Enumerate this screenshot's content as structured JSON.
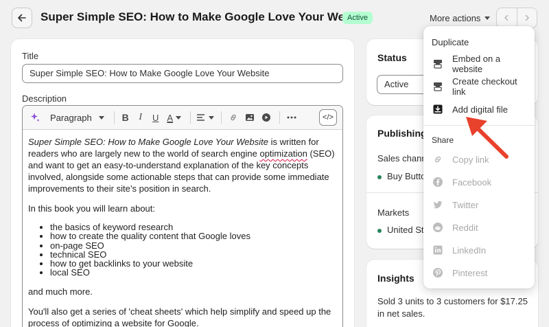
{
  "header": {
    "title": "Super Simple SEO: How to Make Google Love Your Website",
    "status_badge": "Active",
    "more_actions": "More actions"
  },
  "product": {
    "title_label": "Title",
    "title_value": "Super Simple SEO: How to Make Google Love Your Website",
    "description_label": "Description",
    "editor": {
      "paragraph_style": "Paragraph",
      "code_label": "</>",
      "intro_italic": "Super Simple SEO: How to Make Google Love Your Website",
      "intro_a": " is written for readers who are largely new to the world of search engine ",
      "intro_sq": "optimization",
      "intro_b": " (SEO) and want to get an easy-to-understand explanation of the key concepts involved, alongside some actionable steps that can provide some immediate improvements to their site’s position in search.",
      "learn_intro": "In this book you will learn about:",
      "bullets": [
        "the basics of keyword research",
        "how to create the quality content that Google loves",
        "on-page SEO",
        "technical SEO",
        "how to get backlinks to your website",
        "local SEO"
      ],
      "more": "and much more.",
      "cheat_a": "You'll also get a series of 'cheat sheets' which help simplify and speed up the process of ",
      "cheat_sq": "optimizing",
      "cheat_b": " a website for Google."
    }
  },
  "status_card": {
    "title": "Status",
    "value": "Active"
  },
  "publishing_card": {
    "title": "Publishing",
    "sales_channels_label": "Sales channe",
    "sales_channel": "Buy Button",
    "markets_label": "Markets",
    "market": "United Sta"
  },
  "insights_card": {
    "title": "Insights",
    "line1": "Sold 3 units to 3 customers for $17.25",
    "line2": "in net sales."
  },
  "more_actions_menu": {
    "duplicate": "Duplicate",
    "items": [
      "Embed on a website",
      "Create checkout link",
      "Add digital file"
    ],
    "share_label": "Share",
    "share_items": [
      "Copy link",
      "Facebook",
      "Twitter",
      "Reddit",
      "LinkedIn",
      "Pinterest"
    ]
  },
  "colors": {
    "badge_bg": "#b4fed2",
    "badge_text": "#0c5132",
    "annotation_arrow": "#e8412c",
    "status_dot": "#29845a"
  }
}
